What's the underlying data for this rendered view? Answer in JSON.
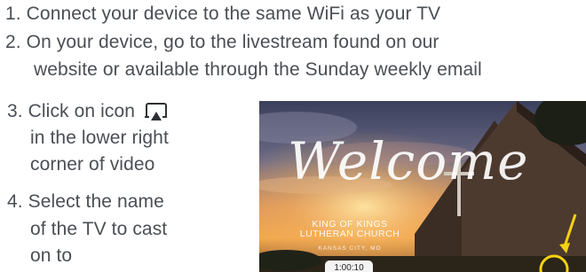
{
  "steps": [
    {
      "number": "1.",
      "lines": [
        "Connect your device to the same WiFi as your TV"
      ]
    },
    {
      "number": "2.",
      "lines": [
        "On your device, go to the livestream found on our",
        "website or available through the Sunday weekly email"
      ]
    },
    {
      "number": "3.",
      "lines": [
        "Click on icon",
        "in the lower right",
        "corner of video"
      ]
    },
    {
      "number": "4.",
      "lines": [
        "Select the name",
        "of the TV to cast",
        "on to"
      ]
    }
  ],
  "step3_icon": "airplay-icon",
  "video": {
    "welcome": "Welcome",
    "church_name": "KING OF KINGS LUTHERAN CHURCH",
    "church_city": "KANSAS CITY, MO",
    "timecode": "1:00:10",
    "arrow_color": "#f5d20f",
    "highlight_circle_color": "#f5d20f"
  },
  "colors": {
    "text": "#4a4f55",
    "icon": "#2d3136"
  }
}
